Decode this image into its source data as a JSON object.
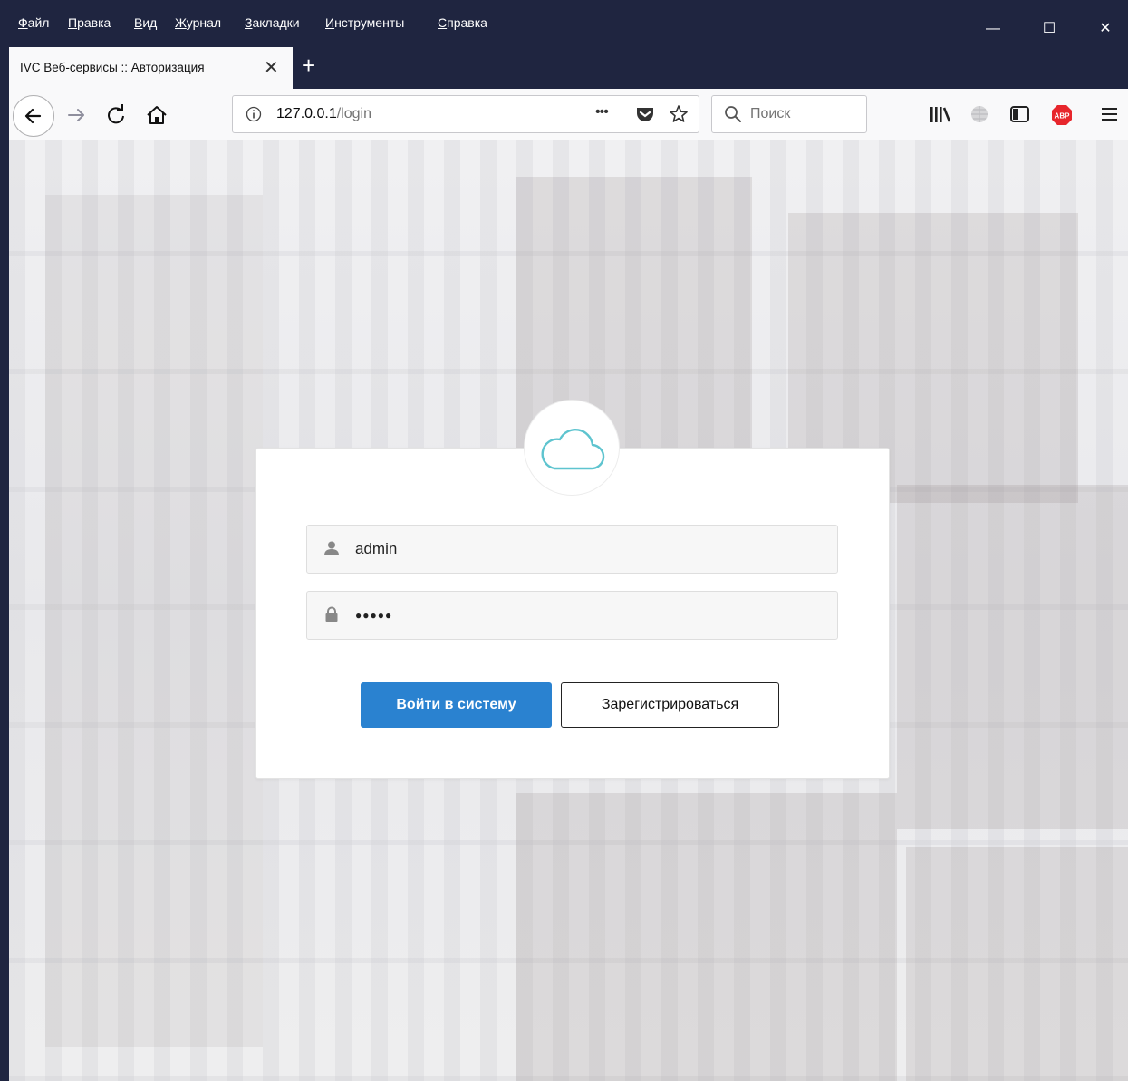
{
  "menu": {
    "items": [
      "Файл",
      "Правка",
      "Вид",
      "Журнал",
      "Закладки",
      "Инструменты",
      "Справка"
    ]
  },
  "window_controls": {
    "minimize": "—",
    "maximize": "☐",
    "close": "✕"
  },
  "tab": {
    "title": "IVC Веб-сервисы :: Авторизация",
    "close": "✕",
    "new_tab": "+"
  },
  "toolbar": {
    "url_host": "127.0.0.1",
    "url_path": "/login",
    "more": "•••",
    "search_placeholder": "Поиск"
  },
  "login": {
    "username": "admin",
    "password_mask": "●●●●●",
    "login_button": "Войти в систему",
    "register_button": "Зарегистрироваться"
  },
  "colors": {
    "chrome": "#1f2540",
    "primary": "#2a82d0",
    "cloud": "#5ec4cf"
  }
}
